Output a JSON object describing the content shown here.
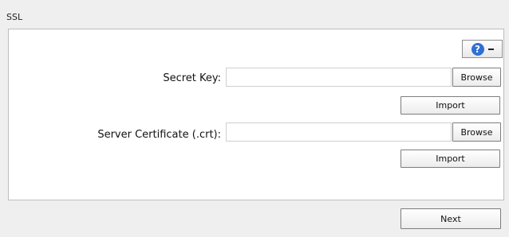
{
  "window": {
    "title": "SSL"
  },
  "help": {
    "icon": "?",
    "menu": "-"
  },
  "secret_key": {
    "label": "Secret Key:",
    "value": "",
    "browse": "Browse",
    "import": "Import"
  },
  "server_certificate": {
    "label": "Server Certificate (.crt):",
    "value": "",
    "browse": "Browse",
    "import": "Import"
  },
  "footer": {
    "button": "Next"
  },
  "colors": {
    "window_background": "#efefef",
    "panel_background": "#ffffff",
    "help_icon": "#2f6fd3"
  },
  "icons": {
    "help": "help-icon",
    "menu": "dropdown-icon"
  }
}
